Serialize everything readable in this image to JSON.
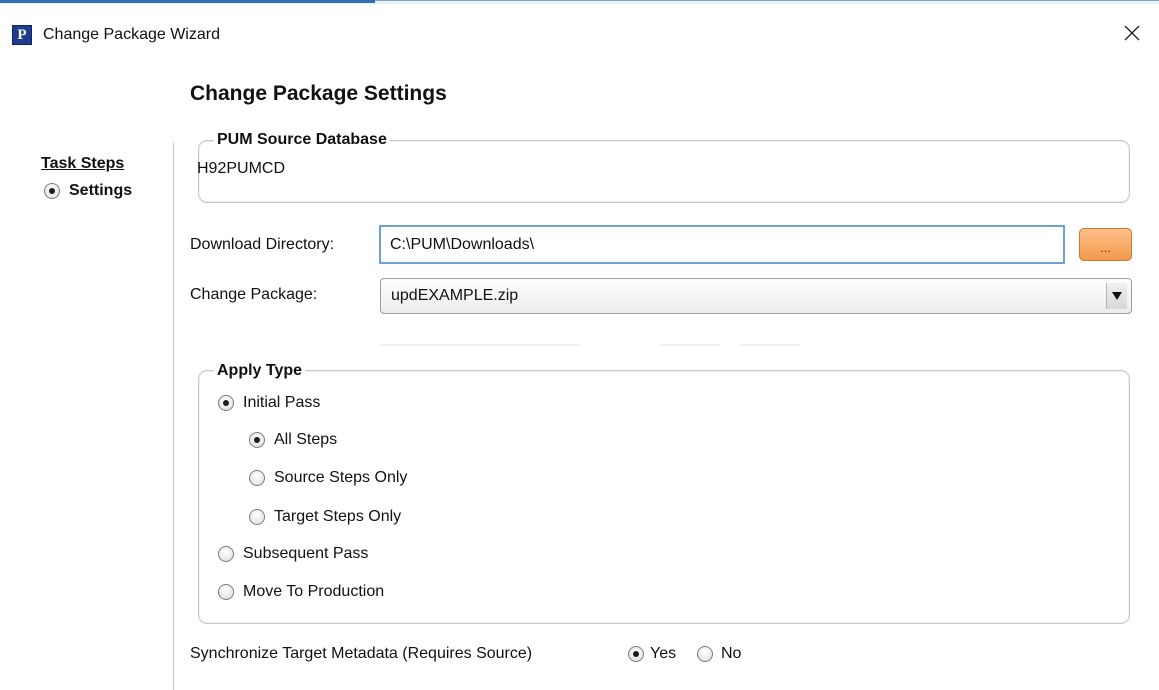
{
  "window": {
    "title": "Change Package Wizard",
    "logo_letter": "P"
  },
  "page": {
    "heading": "Change Package Settings"
  },
  "task_steps": {
    "title": "Task Steps",
    "items": [
      {
        "label": "Settings",
        "selected": true
      }
    ]
  },
  "source_database": {
    "legend": "PUM Source Database",
    "value": "H92PUMCD"
  },
  "download_directory": {
    "label": "Download Directory:",
    "value": "C:\\PUM\\Downloads\\",
    "browse_label": "..."
  },
  "change_package": {
    "label": "Change Package:",
    "selected": "updEXAMPLE.zip"
  },
  "apply_type": {
    "legend": "Apply Type",
    "initial_pass": "Initial Pass",
    "all_steps": "All Steps",
    "source_steps_only": "Source Steps Only",
    "target_steps_only": "Target Steps Only",
    "subsequent_pass": "Subsequent Pass",
    "move_to_production": "Move To Production",
    "selected_pass": "Initial Pass",
    "selected_steps": "All Steps"
  },
  "sync": {
    "label": "Synchronize Target Metadata (Requires Source)",
    "yes": "Yes",
    "no": "No",
    "selected": "Yes"
  },
  "colors": {
    "accent": "#2f6fb5",
    "input_focus_border": "#6ca0d8",
    "browse_button": "#f29a4c",
    "logo": "#1d3d8c"
  }
}
